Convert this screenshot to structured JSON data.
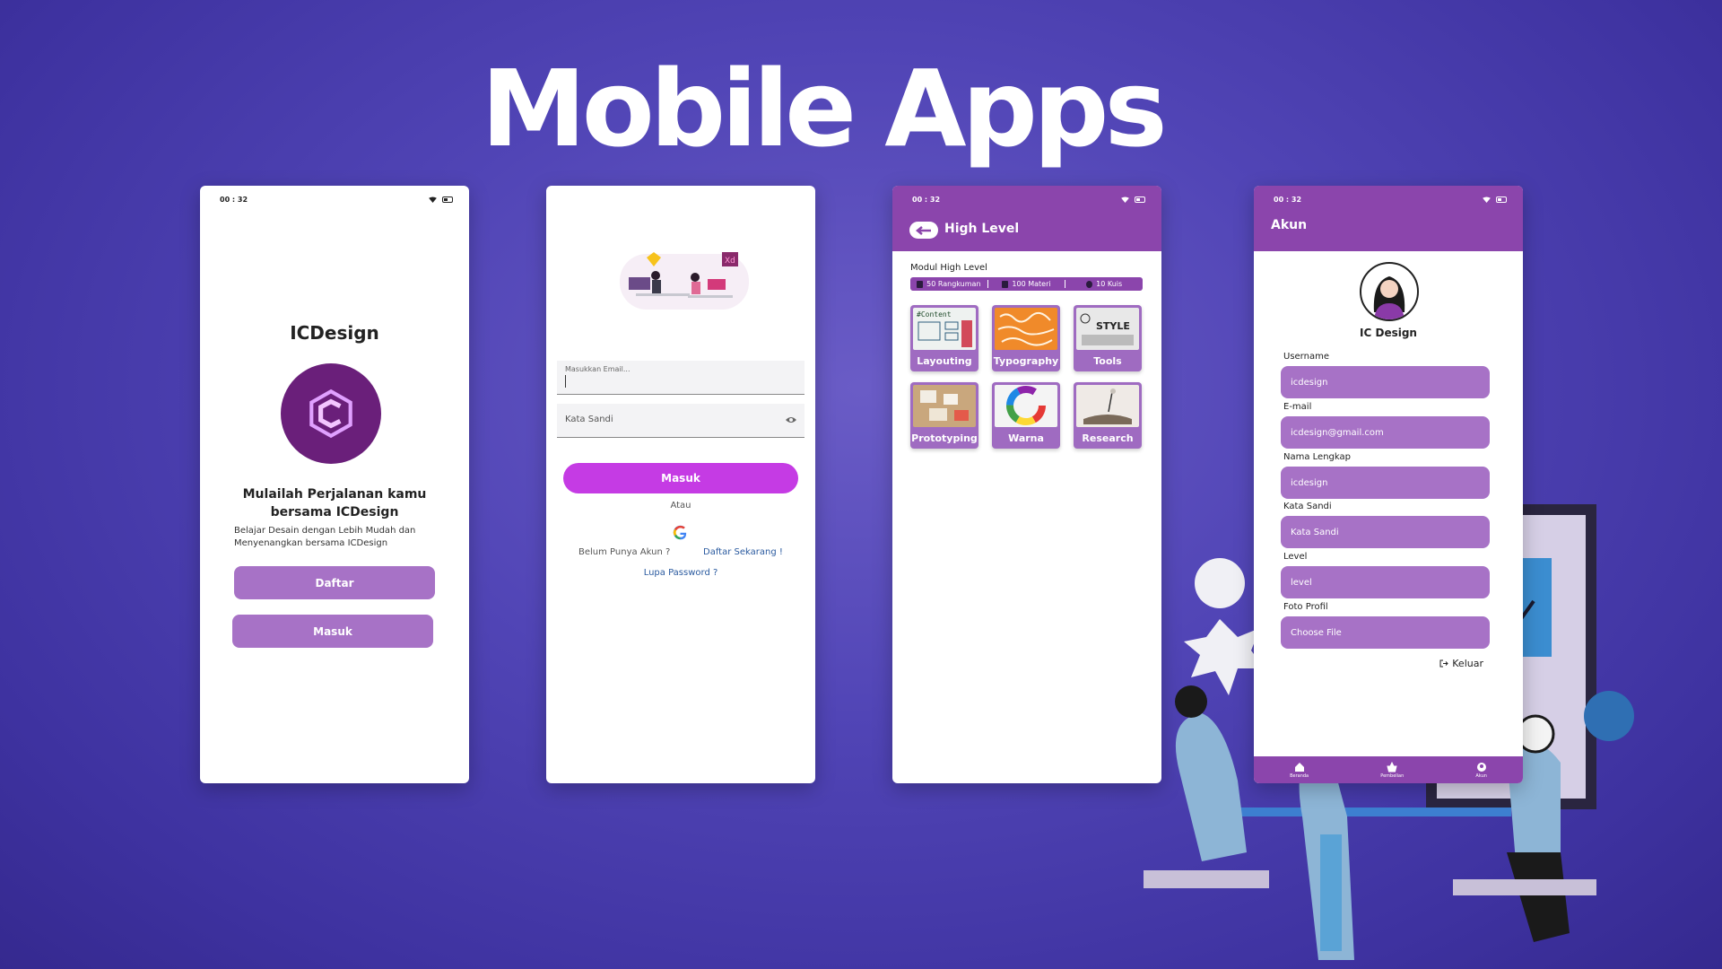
{
  "headline": "Mobile Apps",
  "colors": {
    "background": "#5145b6",
    "accent_purple": "#8b45ac",
    "button_purple": "#a772c6",
    "login_button": "#c53be4",
    "logo_circle": "#6a1f7a"
  },
  "screen_welcome": {
    "time": "00 : 32",
    "app_name": "ICDesign",
    "logo_icon": "ic-logo-icon",
    "tagline_line1": "Mulailah Perjalanan kamu",
    "tagline_line2": "bersama ICDesign",
    "description_line1": "Belajar Desain dengan Lebih Mudah dan",
    "description_line2": "Menyenangkan bersama ICDesign",
    "register_button": "Daftar",
    "login_button": "Masuk"
  },
  "screen_login": {
    "email_placeholder": "Masukkan Email...",
    "password_label": "Kata Sandi",
    "login_button": "Masuk",
    "or_text": "Atau",
    "no_account_text": "Belum Punya Akun ?",
    "register_link": "Daftar Sekarang !",
    "forgot_password_link": "Lupa Password ?",
    "xd_badge": "Xd"
  },
  "screen_high_level": {
    "time": "00 : 32",
    "title": "High Level",
    "module_label": "Modul High Level",
    "stats": [
      "50 Rangkuman",
      "100 Materi",
      "10 Kuis"
    ],
    "tiles": [
      "Layouting",
      "Typography",
      "Tools",
      "Prototyping",
      "Warna",
      "Research"
    ],
    "tile_image_texts": {
      "layouting": "#Content",
      "tools": "STYLE"
    }
  },
  "screen_account": {
    "time": "00 : 32",
    "title": "Akun",
    "profile_name": "IC Design",
    "fields": [
      {
        "label": "Username",
        "value": "icdesign"
      },
      {
        "label": "E-mail",
        "value": "icdesign@gmail.com"
      },
      {
        "label": "Nama Lengkap",
        "value": "icdesign"
      },
      {
        "label": "Kata Sandi",
        "value": "Kata Sandi"
      },
      {
        "label": "Level",
        "value": "level"
      },
      {
        "label": "Foto Profil",
        "value": "Choose File"
      }
    ],
    "logout": "Keluar",
    "nav": [
      "Beranda",
      "Pembelian",
      "Akun"
    ]
  }
}
